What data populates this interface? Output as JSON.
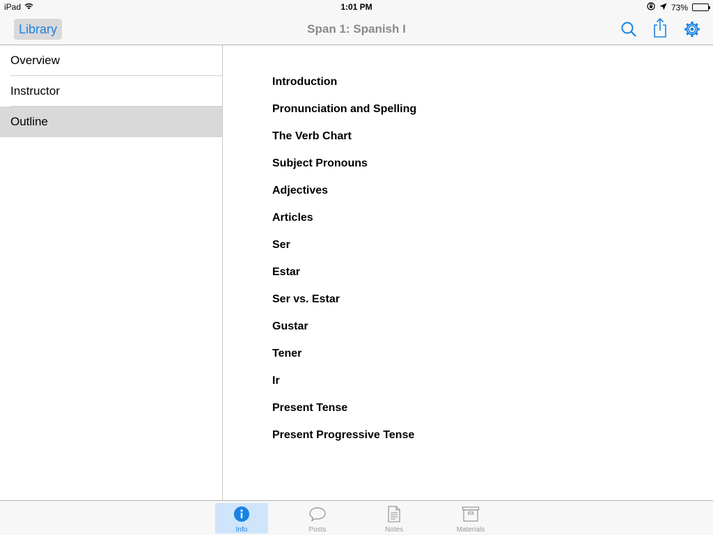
{
  "status_bar": {
    "device": "iPad",
    "time": "1:01 PM",
    "battery": "73%",
    "battery_level": 0.73
  },
  "nav": {
    "back_label": "Library",
    "title": "Span 1: Spanish I",
    "accent_color": "#1a82e2"
  },
  "sidebar": {
    "items": [
      {
        "label": "Overview"
      },
      {
        "label": "Instructor"
      },
      {
        "label": "Outline"
      }
    ],
    "selected": "Outline"
  },
  "outline": {
    "items": [
      "Introduction",
      "Pronunciation and Spelling",
      "The Verb Chart",
      "Subject Pronouns",
      "Adjectives",
      "Articles",
      "Ser",
      "Estar",
      "Ser vs. Estar",
      "Gustar",
      "Tener",
      "Ir",
      "Present Tense",
      "Present Progressive Tense"
    ]
  },
  "tabs": [
    {
      "label": "Info",
      "icon": "info-icon"
    },
    {
      "label": "Posts",
      "icon": "speech-bubble-icon"
    },
    {
      "label": "Notes",
      "icon": "document-icon"
    },
    {
      "label": "Materials",
      "icon": "box-icon"
    }
  ],
  "active_tab": "Info"
}
